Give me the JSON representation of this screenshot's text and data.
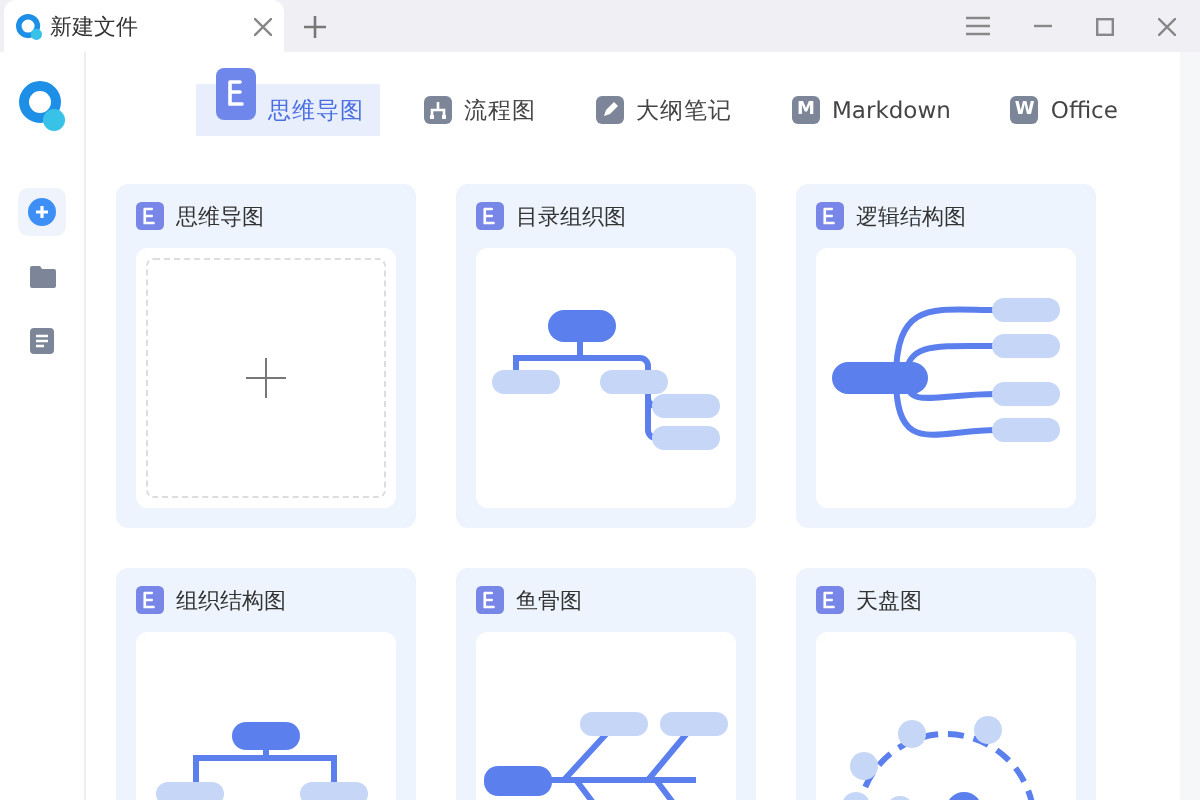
{
  "window": {
    "tab_title": "新建文件"
  },
  "type_tabs": [
    {
      "label": "思维导图",
      "selected": true,
      "kind": "mind"
    },
    {
      "label": "流程图",
      "selected": false,
      "kind": "flow"
    },
    {
      "label": "大纲笔记",
      "selected": false,
      "kind": "outline"
    },
    {
      "label": "Markdown",
      "selected": false,
      "kind": "letter",
      "badge": "M"
    },
    {
      "label": "Office",
      "selected": false,
      "kind": "letter",
      "badge": "W"
    }
  ],
  "sidebar": {
    "items": [
      {
        "kind": "new",
        "selected": true
      },
      {
        "kind": "folder",
        "selected": false
      },
      {
        "kind": "doc",
        "selected": false
      }
    ]
  },
  "templates": [
    {
      "title": "思维导图",
      "kind": "blank"
    },
    {
      "title": "目录组织图",
      "kind": "tree"
    },
    {
      "title": "逻辑结构图",
      "kind": "logic"
    },
    {
      "title": "组织结构图",
      "kind": "org"
    },
    {
      "title": "鱼骨图",
      "kind": "fishbone"
    },
    {
      "title": "天盘图",
      "kind": "radial"
    }
  ]
}
